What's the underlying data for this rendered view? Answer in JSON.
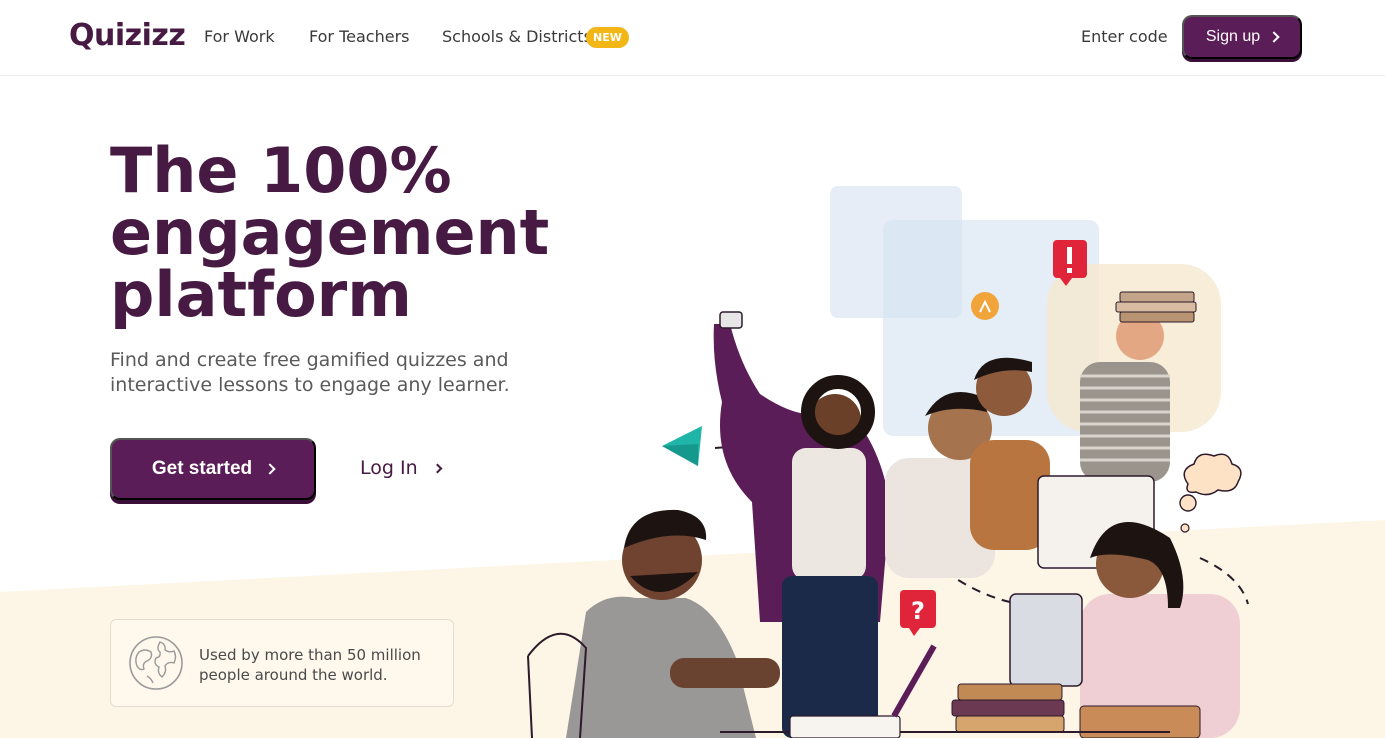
{
  "header": {
    "logo": "Quizizz",
    "nav": [
      {
        "label": "For Work"
      },
      {
        "label": "For Teachers"
      },
      {
        "label": "Schools & Districts",
        "badge": "NEW"
      }
    ],
    "enter_code": "Enter code",
    "signup": "Sign up"
  },
  "hero": {
    "title_lines": [
      "The 100%",
      "engagement",
      "platform"
    ],
    "subtitle": "Find and create free gamified quizzes and interactive lessons to engage any learner.",
    "cta_primary": "Get started",
    "cta_secondary": "Log In"
  },
  "info": {
    "text": "Used by more than 50 million people around the world."
  },
  "colors": {
    "brand": "#5b1d57",
    "brand_dark": "#461a42",
    "badge": "#f2b617",
    "accent_red": "#e0243a",
    "band": "#fdf5e6"
  },
  "icons": {
    "signup": "chevron-right-icon",
    "cta": "chevron-right-icon",
    "info": "globe-icon"
  }
}
